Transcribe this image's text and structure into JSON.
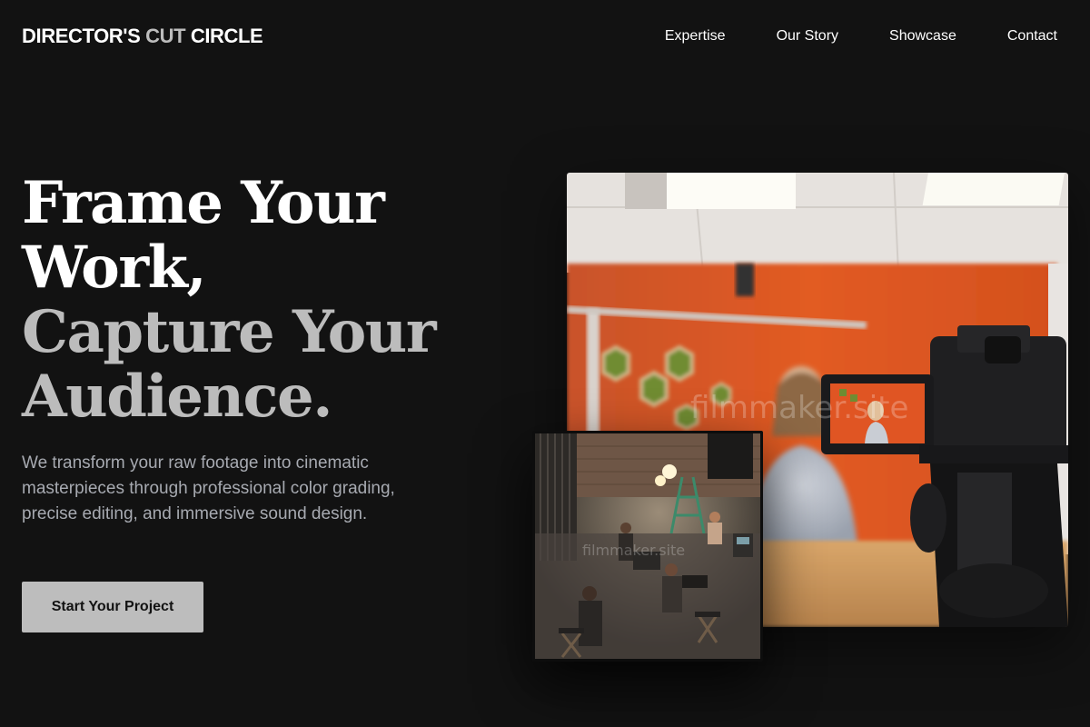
{
  "header": {
    "logo_part1": "DIRECTOR'S ",
    "logo_accent": "CUT",
    "logo_part2": " CIRCLE",
    "nav": [
      {
        "label": "Expertise"
      },
      {
        "label": "Our Story"
      },
      {
        "label": "Showcase"
      },
      {
        "label": "Contact"
      }
    ]
  },
  "hero": {
    "headline_line1": "Frame Your",
    "headline_line2": "Work,",
    "headline_line3": "Capture Your",
    "headline_line4": "Audience.",
    "description": "We transform your raw footage into cinematic masterpieces through professional color grading, precise editing, and immersive sound design.",
    "cta_label": "Start Your Project"
  },
  "images": {
    "watermark_main": "filmmaker.site",
    "watermark_inset": "filmmaker.site"
  },
  "colors": {
    "background": "#121212",
    "text_primary": "#ffffff",
    "text_muted": "#bcbcbc",
    "body_text": "#a7aab1",
    "button_bg": "#bdbdbd",
    "button_text": "#121212",
    "studio_wall": "#e05a23"
  }
}
